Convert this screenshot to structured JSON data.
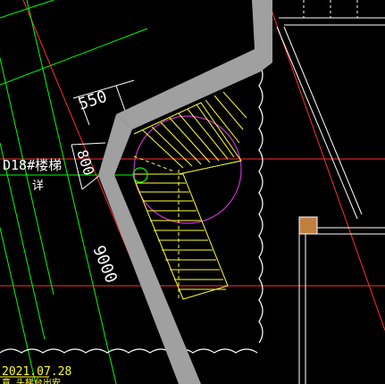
{
  "dimensions": {
    "top": "550",
    "left": "800",
    "diagonal": "9000"
  },
  "labels": {
    "stair_ref": "D18#楼梯",
    "stair_ref_sub": "详",
    "date": "2021.07.28",
    "date_sub": "意 头梯台出安"
  },
  "colors": {
    "background": "#000000",
    "wall_fill": "#a0a0a0",
    "stair_lines": "#ffff33",
    "cloud": "#ffffff",
    "grid_green": "#00ff00",
    "axis_red": "#ff3030",
    "magenta": "#cc33cc",
    "text": "#ffffff",
    "column_fill": "#c08040"
  }
}
